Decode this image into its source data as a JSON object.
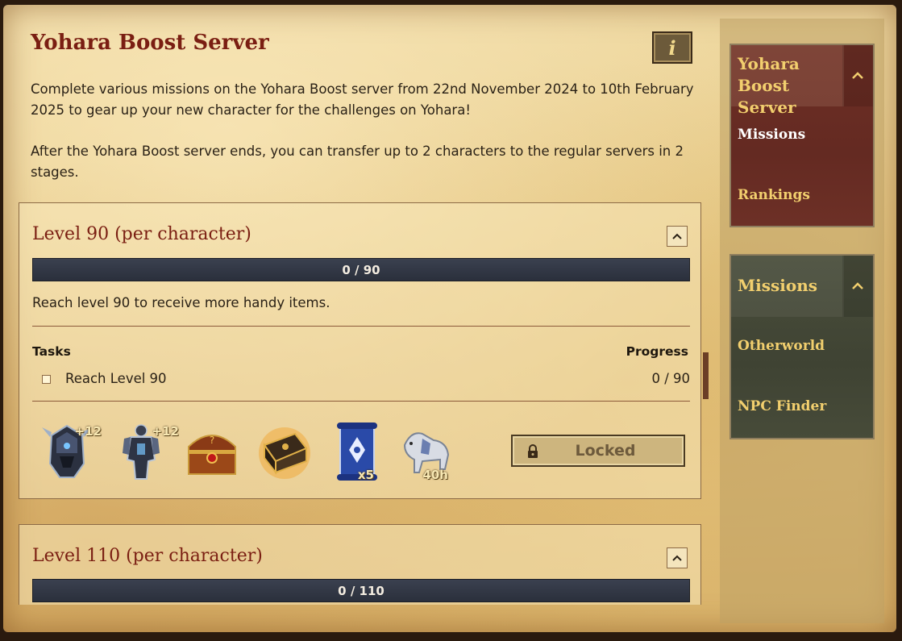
{
  "header": {
    "title": "Yohara Boost Server",
    "info_icon": "i"
  },
  "intro": {
    "paragraph1": "Complete various missions on the Yohara Boost server from 22nd November 2024 to 10th February 2025 to gear up your new character for the challenges on Yohara!",
    "paragraph2": "After the Yohara Boost server ends, you can transfer up to 2 characters to the regular servers in 2 stages."
  },
  "missions": [
    {
      "title": "Level 90 (per character)",
      "progress_text": "0 / 90",
      "progress_fraction": 0,
      "description": "Reach level 90 to receive more handy items.",
      "tasks_header": "Tasks",
      "progress_header": "Progress",
      "tasks": [
        {
          "label": "Reach Level 90",
          "progress": "0 / 90"
        }
      ],
      "rewards": [
        {
          "icon": "helmet-icon",
          "tag": "+12"
        },
        {
          "icon": "armor-icon",
          "tag": "+12"
        },
        {
          "icon": "treasure-chest-icon",
          "tag": ""
        },
        {
          "icon": "gold-chest-icon",
          "tag": ""
        },
        {
          "icon": "scroll-icon",
          "tag": "x5"
        },
        {
          "icon": "mount-icon",
          "tag": "40h"
        }
      ],
      "button_label": "Locked",
      "button_icon": "lock-icon"
    },
    {
      "title": "Level 110 (per character)",
      "progress_text": "0 / 110",
      "progress_fraction": 0
    }
  ],
  "sidebar": {
    "panel1": {
      "title": "Yohara Boost Server",
      "items": [
        "Missions",
        "Rankings"
      ]
    },
    "panel2": {
      "title": "Missions",
      "items": [
        "Otherworld",
        "NPC Finder"
      ]
    }
  },
  "colors": {
    "title_red": "#7a1e12",
    "sidebar_gold": "#f2cf6e",
    "progress_bg": "#2f3440",
    "panel_red": "#642a22",
    "panel_green": "#3f4333"
  }
}
